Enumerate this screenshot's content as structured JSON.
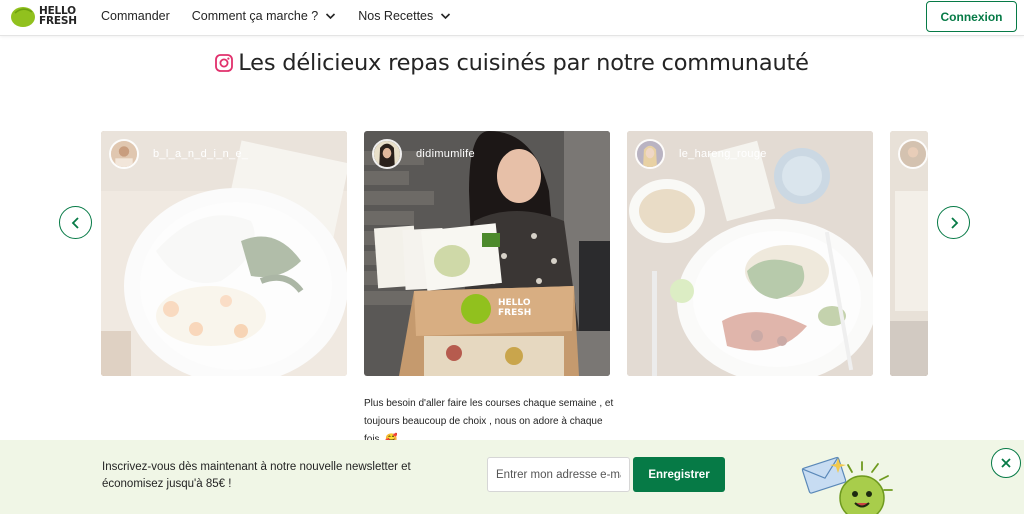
{
  "header": {
    "logo_text_line1": "HELLO",
    "logo_text_line2": "FRESH",
    "nav": [
      {
        "label": "Commander"
      },
      {
        "label": "Comment ça marche ?"
      },
      {
        "label": "Nos Recettes"
      }
    ],
    "login_label": "Connexion"
  },
  "section": {
    "title": "Les délicieux repas cuisinés par notre communauté",
    "icon": "instagram-icon"
  },
  "carousel": {
    "cards": [
      {
        "username": "b_l_a_n_d_i_n_e_"
      },
      {
        "username": "didimumlife"
      },
      {
        "username": "le_hareng_rouge"
      }
    ],
    "active_caption": "Plus besoin d'aller faire les courses chaque semaine , et toujours beaucoup de choix , nous on adore à chaque fois. 🥰",
    "prev_icon": "chevron-left-icon",
    "next_icon": "chevron-right-icon"
  },
  "newsletter": {
    "text": "Inscrivez-vous dès maintenant à notre nouvelle newsletter et économisez jusqu'à 85€ !",
    "email_placeholder": "Entrer mon adresse e-mail",
    "submit_label": "Enregistrer",
    "close_icon": "close-icon"
  },
  "colors": {
    "brand_green": "#067a46",
    "logo_green": "#91c11e",
    "banner_bg": "#f0f6e6",
    "instagram_red": "#e1306c"
  }
}
